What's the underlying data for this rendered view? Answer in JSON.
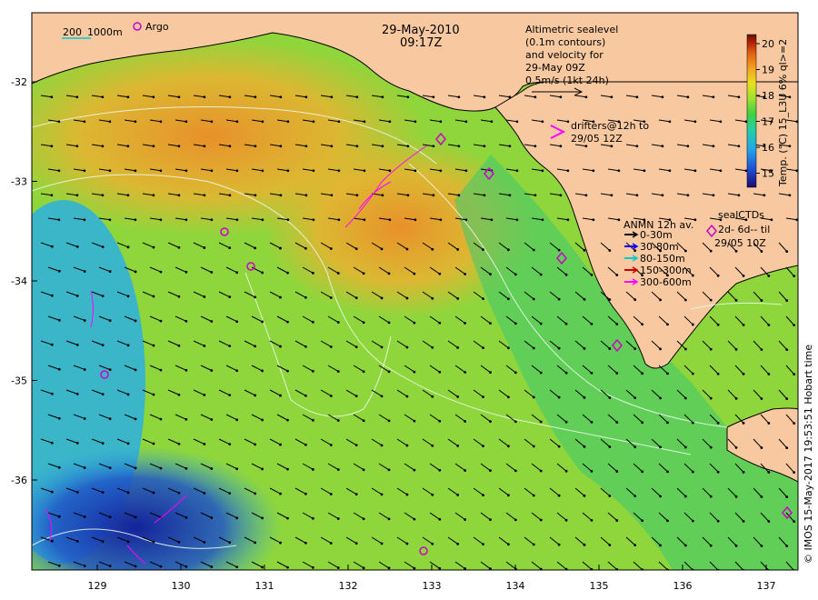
{
  "title": {
    "date": "29-May-2010",
    "time": "09:17Z"
  },
  "scale_bar": {
    "label_200": "200",
    "label_1000": "1000m"
  },
  "argo_legend": {
    "label": "Argo"
  },
  "sealevel_note": {
    "lines": [
      "Altimetric sealevel",
      "(0.1m contours)",
      "and velocity for",
      "29-May 09Z",
      "0.5m/s (1kt 24h)"
    ]
  },
  "drifters_note": {
    "lines": [
      "drifters@12h to",
      "29/05 12Z"
    ]
  },
  "anmn_legend": {
    "title": "ANMN 12h av.",
    "items": [
      {
        "label": "0-30m",
        "color": "#000000"
      },
      {
        "label": "30-80m",
        "color": "#0000ff"
      },
      {
        "label": "80-150m",
        "color": "#00cccc"
      },
      {
        "label": "150-300m",
        "color": "#cc0000"
      },
      {
        "label": "300-600m",
        "color": "#ff00ff"
      }
    ]
  },
  "seal_legend": {
    "lines": [
      "sealCTDs",
      "2d- 6d-- til",
      "29/05 10Z"
    ]
  },
  "colorbar": {
    "ticks": [
      "20",
      "19",
      "18",
      "17",
      "16",
      "15"
    ],
    "label": "Temp. (°C) 15_L3U 6% ql>=2",
    "colors": [
      "#1a0a6e",
      "#1f4fd6",
      "#23a6e8",
      "#25d0a0",
      "#40d040",
      "#a0e030",
      "#e8e020",
      "#f4a020",
      "#e06010",
      "#b02008",
      "#6a1006"
    ]
  },
  "x_axis": {
    "ticks": [
      "129",
      "130",
      "131",
      "132",
      "133",
      "134",
      "135",
      "136",
      "137"
    ]
  },
  "y_axis": {
    "ticks": [
      "-32",
      "-33",
      "-34",
      "-35",
      "-36"
    ]
  },
  "credit": "© IMOS 15-May-2017 19:53:51 Hobart time",
  "colors": {
    "land": "#f8c9a0",
    "ocean_warm": "#e89a30",
    "ocean_mid": "#9cd83a",
    "ocean_cool": "#2da8e8",
    "ocean_cold": "#1a3fb0"
  }
}
